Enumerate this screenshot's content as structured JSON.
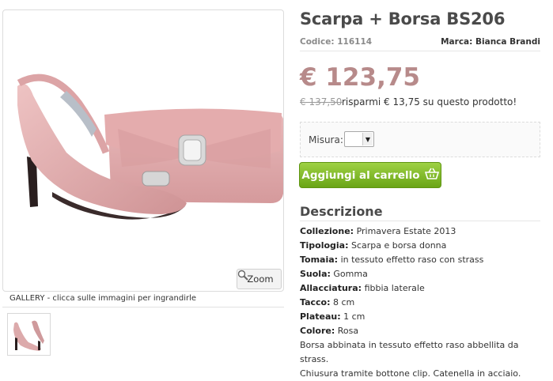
{
  "product": {
    "title": "Scarpa + Borsa BS206",
    "code_label": "Codice:",
    "code_value": "116114",
    "brand_label": "Marca:",
    "brand_value": "Bianca Brandi",
    "price": "€ 123,75",
    "old_price": "€ 137,50",
    "savings_text": "risparmi € 13,75 su questo prodotto!"
  },
  "options": {
    "size_label": "Misura:",
    "size_value": ""
  },
  "cart": {
    "button_label": "Aggiungi al carrello",
    "icon": "basket-icon"
  },
  "gallery": {
    "zoom_label": "Zoom",
    "zoom_icon": "magnifier-icon",
    "caption": "GALLERY - clicca sulle immagini per ingrandirle"
  },
  "description": {
    "heading": "Descrizione",
    "rows": [
      {
        "label": "Collezione:",
        "value": "Primavera Estate 2013"
      },
      {
        "label": "Tipologia:",
        "value": "Scarpa e borsa donna"
      },
      {
        "label": "Tomaia:",
        "value": "in tessuto effetto raso con strass"
      },
      {
        "label": "Suola:",
        "value": "Gomma"
      },
      {
        "label": "Allacciatura:",
        "value": "fibbia laterale"
      },
      {
        "label": "Tacco:",
        "value": "8 cm"
      },
      {
        "label": "Plateau:",
        "value": "1 cm"
      },
      {
        "label": "Colore:",
        "value": "Rosa"
      }
    ],
    "extra_line_1": "Borsa abbinata in tessuto effetto raso abbellita da strass.",
    "extra_line_2": "Chiusura tramite bottone clip. Catenella in acciaio."
  },
  "colors": {
    "price": "#b78a8a",
    "cart_button": "#7cb622",
    "product_pink": "#e2aeb0"
  }
}
